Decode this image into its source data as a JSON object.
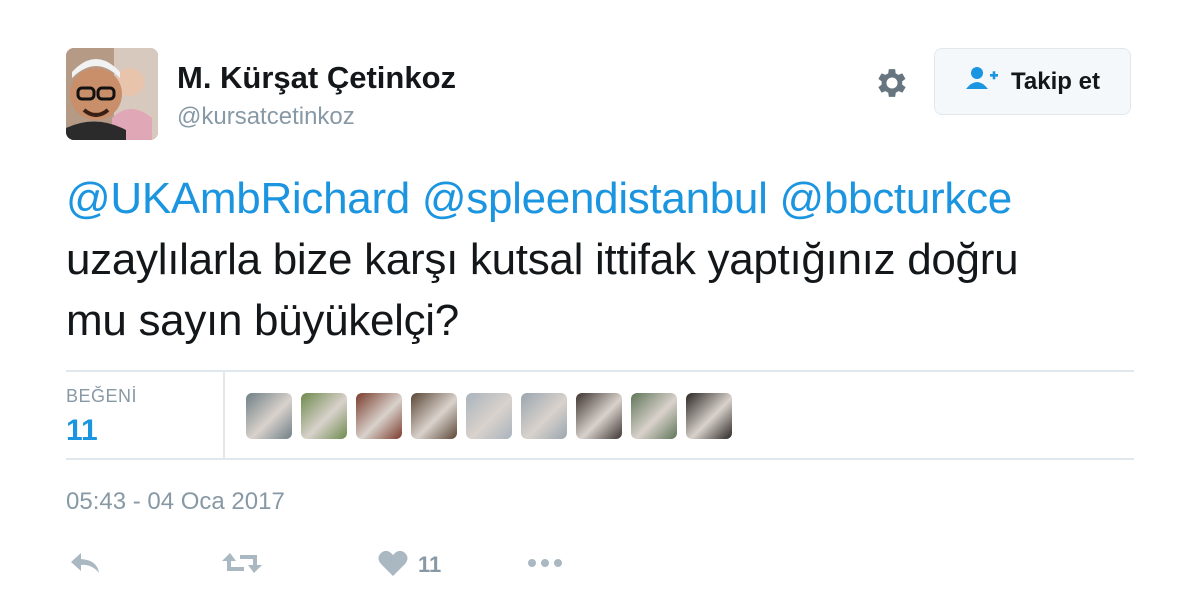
{
  "user": {
    "display_name": "M. Kürşat Çetinkoz",
    "handle": "@kursatcetinkoz",
    "avatar": "user-avatar-photo"
  },
  "follow_button": {
    "label": "Takip et",
    "icon": "follow-user-icon"
  },
  "settings_icon": "gear-icon",
  "tweet": {
    "mentions": [
      "@UKAmbRichard",
      "@spleendistanbul",
      "@bbcturkce"
    ],
    "line2": "uzaylılarla bize karşı kutsal ittifak yaptığınız doğru",
    "line3": "mu sayın büyükelçi?"
  },
  "stats": {
    "likes_label": "BEĞENİ",
    "likes_count": "11",
    "likers": [
      {
        "name": "liker-avatar-1",
        "color": "#6f7f86"
      },
      {
        "name": "liker-avatar-2",
        "color": "#6d8a4c"
      },
      {
        "name": "liker-avatar-3",
        "color": "#7a3b2c"
      },
      {
        "name": "liker-avatar-4",
        "color": "#5a4636"
      },
      {
        "name": "liker-avatar-5",
        "color": "#a9b3bd"
      },
      {
        "name": "liker-avatar-6",
        "color": "#9aa6b0"
      },
      {
        "name": "liker-avatar-7",
        "color": "#3d3431"
      },
      {
        "name": "liker-avatar-8",
        "color": "#5f7558"
      },
      {
        "name": "liker-avatar-9",
        "color": "#2a2624"
      }
    ]
  },
  "timestamp": "05:43 - 04 Oca 2017",
  "actions": {
    "reply_icon": "reply-icon",
    "retweet_icon": "retweet-icon",
    "like_icon": "heart-icon",
    "like_count": "11",
    "more_icon": "more-icon"
  },
  "colors": {
    "link": "#1b95e0",
    "muted": "#8899a6",
    "text": "#14171a",
    "border": "#e1e8ed",
    "icon": "#aab8c2"
  }
}
